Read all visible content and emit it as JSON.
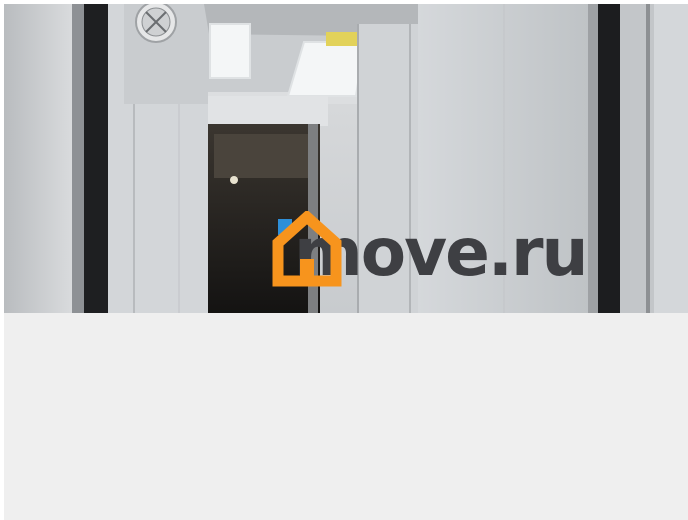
{
  "watermark": {
    "text": "move.ru"
  },
  "colors": {
    "brand_orange": "#f7941d",
    "brand_blue": "#2e8fd8",
    "brand_text": "#3e3f43",
    "empty_area": "#efefef"
  },
  "icons": {
    "house": "house-logo-icon",
    "vent": "ventilation-grille-icon"
  }
}
